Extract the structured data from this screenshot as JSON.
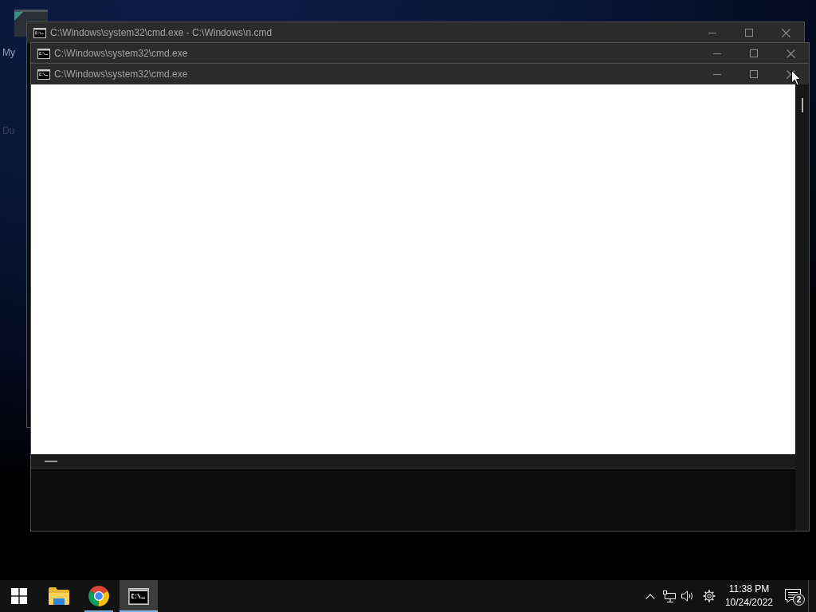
{
  "desktop": {
    "icon_labels": [
      "My",
      "Du"
    ]
  },
  "windows": [
    {
      "title": "C:\\Windows\\system32\\cmd.exe - C:\\Windows\\n.cmd"
    },
    {
      "title": "C:\\Windows\\system32\\cmd.exe"
    },
    {
      "title": "C:\\Windows\\system32\\cmd.exe"
    }
  ],
  "taskbar": {
    "apps": [
      {
        "kind": "folder",
        "running": false,
        "selected": false
      },
      {
        "kind": "browser",
        "running": true,
        "selected": false
      },
      {
        "kind": "console",
        "running": true,
        "selected": true
      }
    ],
    "clock": {
      "time": "11:38 PM",
      "date": "10/24/2022"
    },
    "notifications": {
      "badge": "2"
    }
  }
}
